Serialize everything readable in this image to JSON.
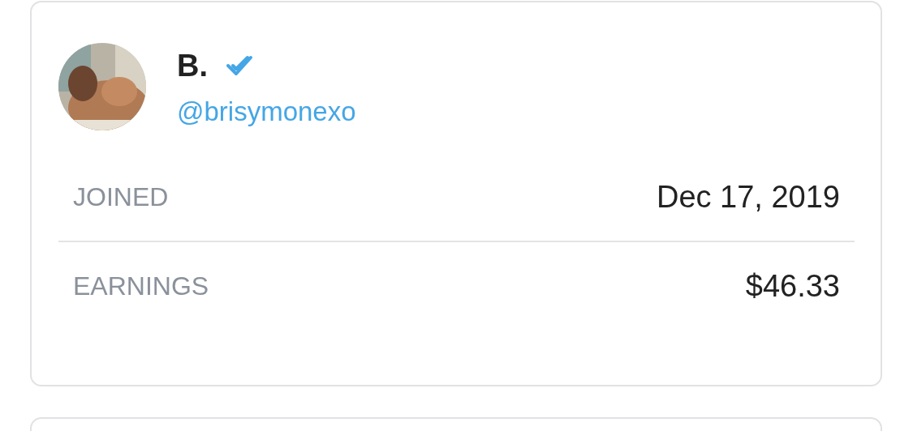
{
  "profile": {
    "name": "B.",
    "verified": true,
    "handle": "@brisymonexo"
  },
  "stats": [
    {
      "label": "JOINED",
      "value": "Dec 17, 2019"
    },
    {
      "label": "EARNINGS",
      "value": "$46.33"
    }
  ]
}
